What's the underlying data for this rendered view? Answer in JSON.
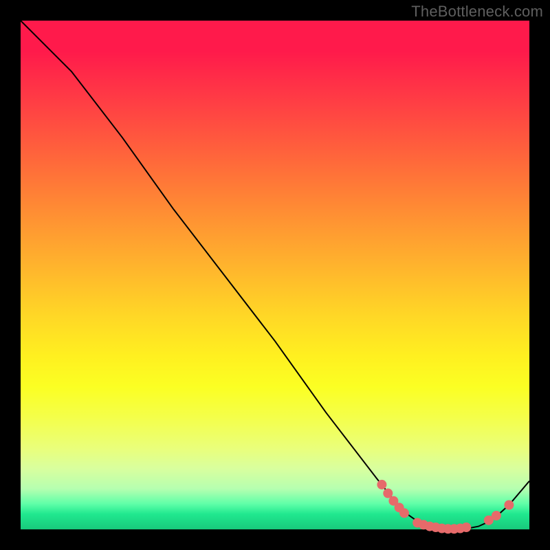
{
  "watermark": "TheBottleneck.com",
  "colors": {
    "bg": "#000000",
    "watermark": "#5f5f5f",
    "curve": "#000000",
    "marker": "#e66a6a"
  },
  "chart_data": {
    "type": "line",
    "title": "",
    "xlabel": "",
    "ylabel": "",
    "xlim": [
      0,
      100
    ],
    "ylim": [
      0,
      100
    ],
    "series": [
      {
        "name": "curve",
        "x": [
          0,
          6,
          10,
          20,
          30,
          40,
          50,
          60,
          70,
          74,
          76,
          78,
          80,
          82,
          84,
          86,
          88,
          90,
          92,
          94,
          96,
          100
        ],
        "y": [
          100,
          94,
          90,
          77,
          63,
          50,
          37,
          23,
          10,
          5,
          3,
          1.6,
          0.8,
          0.3,
          0.1,
          0.1,
          0.2,
          0.6,
          1.5,
          3.0,
          4.8,
          9.5
        ]
      }
    ],
    "markers": [
      {
        "x": 71.0,
        "y": 8.8
      },
      {
        "x": 72.2,
        "y": 7.1
      },
      {
        "x": 73.3,
        "y": 5.6
      },
      {
        "x": 74.4,
        "y": 4.3
      },
      {
        "x": 75.4,
        "y": 3.2
      },
      {
        "x": 78.0,
        "y": 1.3
      },
      {
        "x": 79.2,
        "y": 0.9
      },
      {
        "x": 80.4,
        "y": 0.6
      },
      {
        "x": 81.6,
        "y": 0.4
      },
      {
        "x": 82.8,
        "y": 0.2
      },
      {
        "x": 84.0,
        "y": 0.1
      },
      {
        "x": 85.2,
        "y": 0.1
      },
      {
        "x": 86.4,
        "y": 0.2
      },
      {
        "x": 87.6,
        "y": 0.4
      },
      {
        "x": 92.0,
        "y": 1.8
      },
      {
        "x": 93.5,
        "y": 2.7
      },
      {
        "x": 96.0,
        "y": 4.8
      }
    ]
  }
}
